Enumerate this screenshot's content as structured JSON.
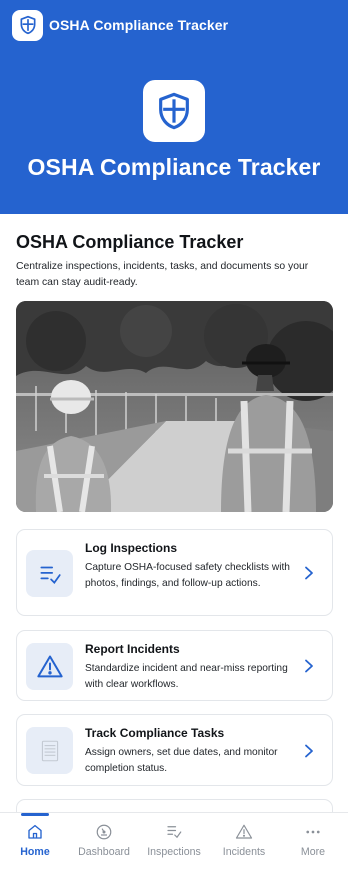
{
  "app_bar": {
    "title": "OSHA Compliance Tracker",
    "icon": "shield-icon"
  },
  "hero": {
    "title": "OSHA Compliance Tracker",
    "icon": "shield-icon"
  },
  "main": {
    "title": "OSHA Compliance Tracker",
    "description": "Centralize inspections, incidents, tasks, and documents so your team can stay audit-ready."
  },
  "cards": [
    {
      "title": "Log Inspections",
      "description": "Capture OSHA-focused safety checklists with photos, findings, and follow-up actions.",
      "icon": "checklist-icon"
    },
    {
      "title": "Report Incidents",
      "description": "Standardize incident and near-miss reporting with clear workflows.",
      "icon": "warning-icon"
    },
    {
      "title": "Track Compliance Tasks",
      "description": "Assign owners, set due dates, and monitor completion status.",
      "icon": "task-list-icon"
    }
  ],
  "tabbar": {
    "tabs": [
      {
        "label": "Home",
        "icon": "home-icon",
        "active": true
      },
      {
        "label": "Dashboard",
        "icon": "dashboard-icon",
        "active": false
      },
      {
        "label": "Inspections",
        "icon": "checklist-icon",
        "active": false
      },
      {
        "label": "Incidents",
        "icon": "warning-icon",
        "active": false
      },
      {
        "label": "More",
        "icon": "more-icon",
        "active": false
      }
    ]
  },
  "colors": {
    "brand": "#2563cf",
    "icon_bg": "#e7edf7",
    "tab_inactive": "#8a9098"
  }
}
